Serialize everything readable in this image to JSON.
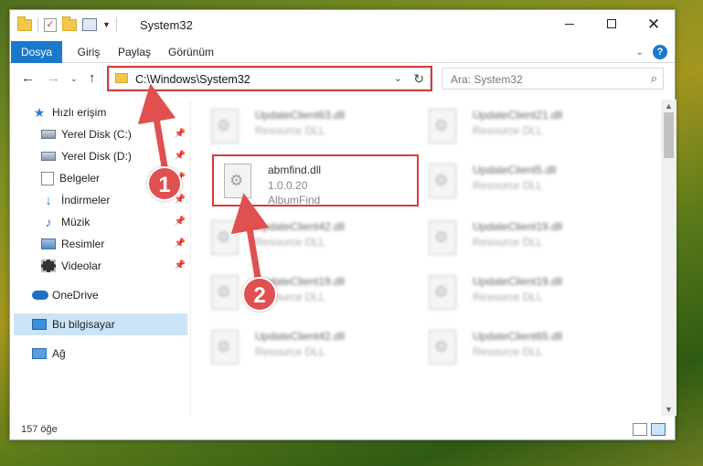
{
  "window": {
    "title": "System32"
  },
  "ribbon": {
    "tabs": [
      "Dosya",
      "Giriş",
      "Paylaş",
      "Görünüm"
    ]
  },
  "address": {
    "path": "C:\\Windows\\System32"
  },
  "search": {
    "placeholder": "Ara: System32"
  },
  "sidebar": {
    "items": [
      {
        "label": "Hızlı erişim",
        "icon": "star-icon"
      },
      {
        "label": "Yerel Disk (C:)",
        "icon": "disk-icon",
        "pinned": true
      },
      {
        "label": "Yerel Disk (D:)",
        "icon": "disk-icon",
        "pinned": true
      },
      {
        "label": "Belgeler",
        "icon": "document-icon",
        "pinned": true
      },
      {
        "label": "İndirmeler",
        "icon": "download-icon",
        "pinned": true
      },
      {
        "label": "Müzik",
        "icon": "music-icon",
        "pinned": true
      },
      {
        "label": "Resimler",
        "icon": "picture-icon",
        "pinned": true
      },
      {
        "label": "Videolar",
        "icon": "video-icon",
        "pinned": true
      },
      {
        "label": "OneDrive",
        "icon": "cloud-icon"
      },
      {
        "label": "Bu bilgisayar",
        "icon": "computer-icon",
        "selected": true
      },
      {
        "label": "Ağ",
        "icon": "network-icon"
      }
    ]
  },
  "files": {
    "highlighted": {
      "name": "abmfind.dll",
      "version": "1.0.0.20",
      "description": "AlbumFind"
    },
    "blurred": [
      {
        "name": "UpdateClient63.dll",
        "type": "Resource DLL"
      },
      {
        "name": "UpdateClient21.dll",
        "type": "Resource DLL"
      },
      {
        "name": "UpdateClient5.dll",
        "type": "Resource DLL"
      },
      {
        "name": "UpdateClient42.dll",
        "type": "Resource DLL"
      },
      {
        "name": "UpdateClient19.dll",
        "type": "Resource DLL"
      },
      {
        "name": "UpdateClient19.dll",
        "type": "Resource DLL"
      },
      {
        "name": "UpdateClient19.dll",
        "type": "Resource DLL"
      },
      {
        "name": "UpdateClient42.dll",
        "type": "Resource DLL"
      },
      {
        "name": "UpdateClient65.dll",
        "type": "Resource DLL"
      }
    ]
  },
  "status": {
    "count": "157 öğe"
  },
  "callouts": [
    "1",
    "2"
  ],
  "colors": {
    "accent": "#1979ca",
    "highlight": "#d63b3b",
    "selection": "#cce4f7"
  }
}
